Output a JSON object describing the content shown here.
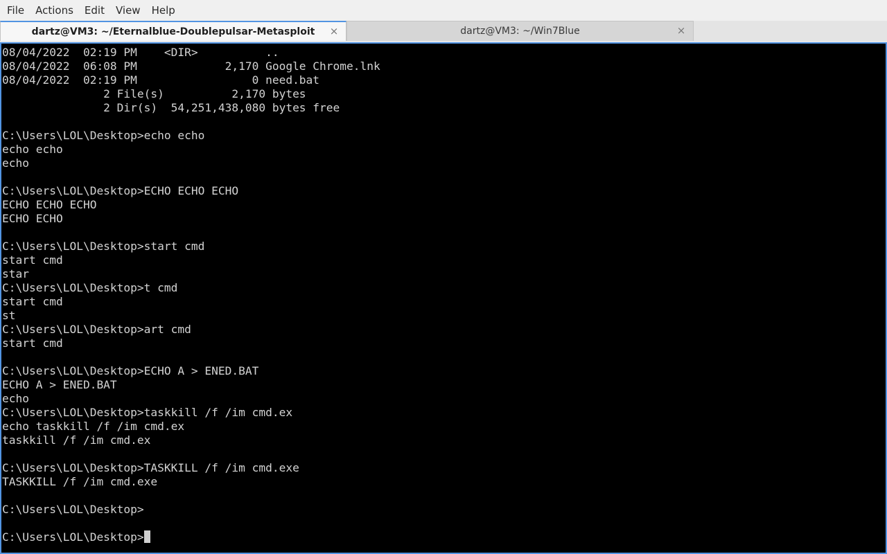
{
  "menubar": {
    "items": [
      "File",
      "Actions",
      "Edit",
      "View",
      "Help"
    ]
  },
  "tabs": [
    {
      "label": "dartz@VM3: ~/Eternalblue-Doublepulsar-Metasploit",
      "active": true
    },
    {
      "label": "dartz@VM3: ~/Win7Blue",
      "active": false
    }
  ],
  "icons": {
    "tab_close": "close-icon",
    "close_glyph": "×"
  },
  "colors": {
    "terminal_bg": "#000000",
    "terminal_fg": "#d3d3d3",
    "accent": "#5294e2"
  },
  "terminal": {
    "lines": [
      "08/04/2022  02:19 PM    <DIR>          ..",
      "08/04/2022  06:08 PM             2,170 Google Chrome.lnk",
      "08/04/2022  02:19 PM                 0 need.bat",
      "               2 File(s)          2,170 bytes",
      "               2 Dir(s)  54,251,438,080 bytes free",
      "",
      "C:\\Users\\LOL\\Desktop>echo echo",
      "echo echo",
      "echo",
      "",
      "C:\\Users\\LOL\\Desktop>ECHO ECHO ECHO",
      "ECHO ECHO ECHO",
      "ECHO ECHO",
      "",
      "C:\\Users\\LOL\\Desktop>start cmd",
      "start cmd",
      "star",
      "C:\\Users\\LOL\\Desktop>t cmd",
      "start cmd",
      "st",
      "C:\\Users\\LOL\\Desktop>art cmd",
      "start cmd",
      "",
      "C:\\Users\\LOL\\Desktop>ECHO A > ENED.BAT",
      "ECHO A > ENED.BAT",
      "echo",
      "C:\\Users\\LOL\\Desktop>taskkill /f /im cmd.ex",
      "echo taskkill /f /im cmd.ex",
      "taskkill /f /im cmd.ex",
      "",
      "C:\\Users\\LOL\\Desktop>TASKKILL /f /im cmd.exe",
      "TASKKILL /f /im cmd.exe",
      "",
      "C:\\Users\\LOL\\Desktop>",
      ""
    ],
    "prompt_line": "C:\\Users\\LOL\\Desktop>"
  }
}
